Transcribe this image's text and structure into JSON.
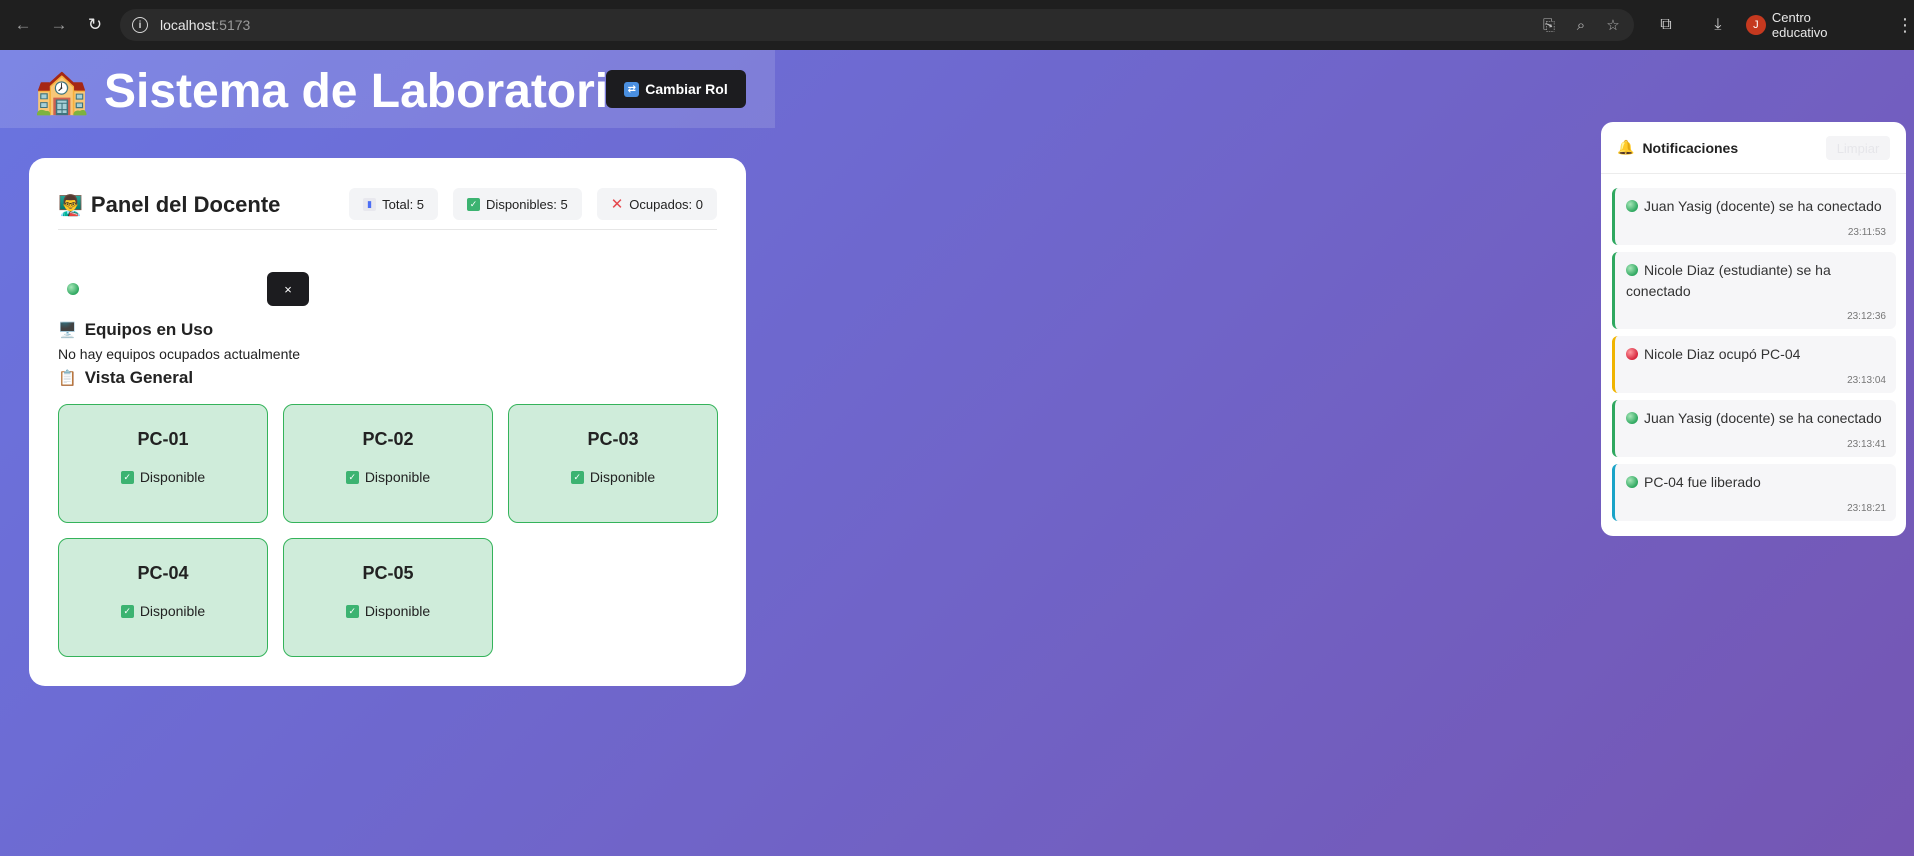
{
  "browser": {
    "url_host": "localhost",
    "url_port": ":5173",
    "profile_initial": "J",
    "profile_name": "Centro educativo"
  },
  "header": {
    "title": "Sistema de Laboratorio",
    "emoji": "🏫",
    "role_button": "Cambiar Rol"
  },
  "panel": {
    "title": "Panel del Docente",
    "title_emoji": "👨‍🏫",
    "stats": {
      "total": "Total: 5",
      "available": "Disponibles: 5",
      "occupied": "Ocupados: 0"
    },
    "close_label": "×",
    "in_use_title": "Equipos en Uso",
    "in_use_empty": "No hay equipos ocupados actualmente",
    "overview_title": "Vista General",
    "computers": [
      {
        "name": "PC-01",
        "status": "Disponible"
      },
      {
        "name": "PC-02",
        "status": "Disponible"
      },
      {
        "name": "PC-03",
        "status": "Disponible"
      },
      {
        "name": "PC-04",
        "status": "Disponible"
      },
      {
        "name": "PC-05",
        "status": "Disponible"
      }
    ]
  },
  "notifications": {
    "title": "Notificaciones",
    "clear_label": "Limpiar",
    "items": [
      {
        "text": "Juan Yasig (docente) se ha conectado",
        "time": "23:11:53",
        "accent": "#2fa860",
        "dot": "green"
      },
      {
        "text": "Nicole Diaz (estudiante) se ha conectado",
        "time": "23:12:36",
        "accent": "#2fa860",
        "dot": "green"
      },
      {
        "text": "Nicole Diaz ocupó PC-04",
        "time": "23:13:04",
        "accent": "#f0b400",
        "dot": "red"
      },
      {
        "text": "Juan Yasig (docente) se ha conectado",
        "time": "23:13:41",
        "accent": "#2fa860",
        "dot": "green"
      },
      {
        "text": "PC-04 fue liberado",
        "time": "23:18:21",
        "accent": "#1aa3c8",
        "dot": "green"
      }
    ]
  },
  "colors": {
    "card_bg": "#cfecda",
    "card_border": "#34b35a",
    "button_dark": "#1c1c1f"
  }
}
